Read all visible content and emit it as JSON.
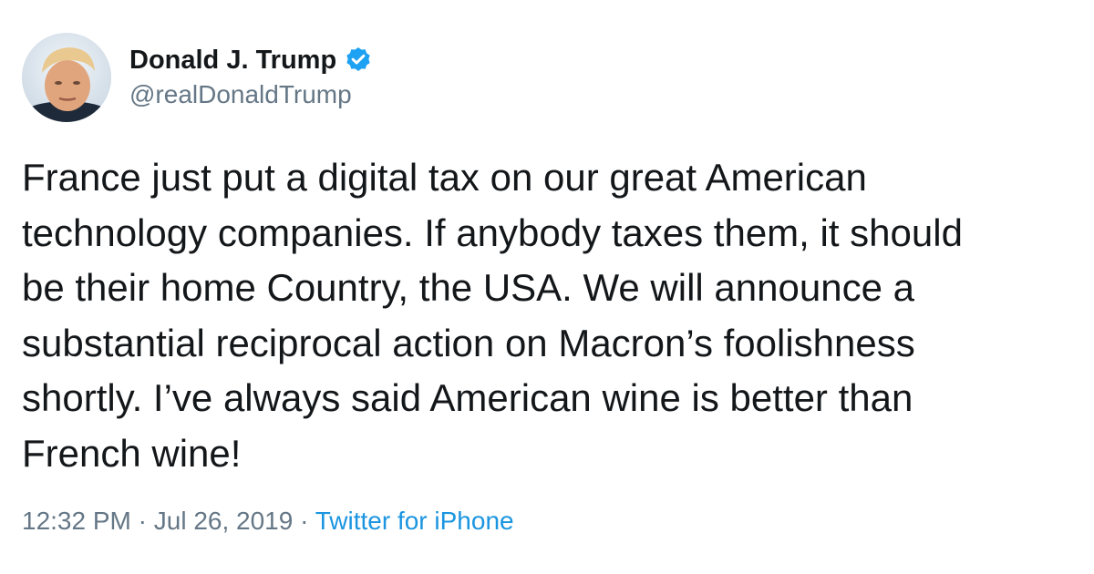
{
  "author": {
    "display_name": "Donald J. Trump",
    "handle": "@realDonaldTrump",
    "verified": true,
    "verified_icon": "verified-badge-icon",
    "avatar_icon": "profile-photo"
  },
  "tweet": {
    "text": "France just put a digital tax on our great American\ntechnology companies. If anybody taxes them, it should\nbe their home Country, the USA. We will announce a\nsubstantial reciprocal action on Macron’s foolishness\nshortly. I’ve always said American wine is better than\nFrench wine!"
  },
  "meta": {
    "time": "12:32 PM",
    "separator": "·",
    "date": "Jul 26, 2019",
    "source": "Twitter for iPhone"
  },
  "colors": {
    "text": "#14171a",
    "secondary": "#657786",
    "link": "#1b95e0",
    "verified": "#1da1f2",
    "background": "#ffffff"
  }
}
